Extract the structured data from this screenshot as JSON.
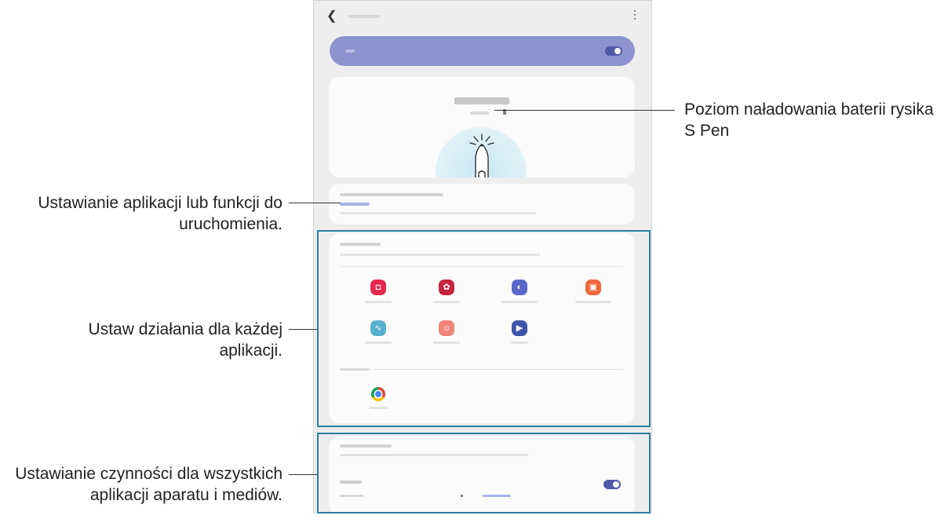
{
  "screen": {
    "accent_color": "#4f59a8",
    "master_bar_color": "#8c93cf",
    "highlight_color": "#2a7fa8",
    "icons": {
      "back": "chevron-left",
      "more": "vertical-ellipsis",
      "spen": "s-pen-stylus"
    },
    "apps": [
      {
        "icon": "camera-icon",
        "color": "#e8294f",
        "glyph": "◘"
      },
      {
        "icon": "gallery-icon",
        "color": "#c4243f",
        "glyph": "✿"
      },
      {
        "icon": "internet-icon",
        "color": "#5a67c9",
        "glyph": "◐"
      },
      {
        "icon": "notes-icon",
        "color": "#f1663a",
        "glyph": "▣"
      },
      {
        "icon": "voice-recorder-icon",
        "color": "#58b1cf",
        "glyph": "∿"
      },
      {
        "icon": "ar-emoji-icon",
        "color": "#f08479",
        "glyph": "☺"
      },
      {
        "icon": "video-player-icon",
        "color": "#3f54a8",
        "glyph": "▶"
      }
    ],
    "other_apps": [
      {
        "icon": "chrome-icon"
      }
    ]
  },
  "callouts": {
    "battery": "Poziom naładowania baterii rysika S Pen",
    "shortcut": "Ustawianie aplikacji lub funkcji do uruchomienia.",
    "app_actions": "Ustaw działania dla każdej aplikacji.",
    "general_actions": "Ustawianie czynności dla wszystkich aplikacji aparatu i mediów."
  }
}
